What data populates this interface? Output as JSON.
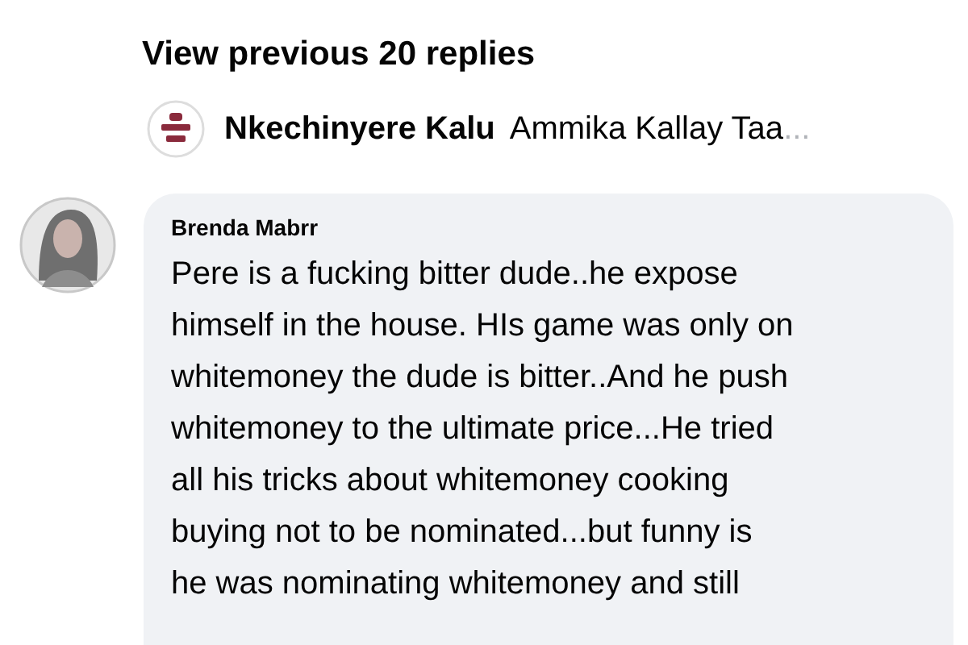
{
  "view_previous": "View previous 20 replies",
  "reply_preview": {
    "author": "Nkechinyere Kalu",
    "text": "Ammika Kallay Taa",
    "ellipsis": "..."
  },
  "comment": {
    "author": "Brenda Mabrr",
    "lines": [
      "Pere is a fucking bitter dude..he expose",
      "himself in the house. HIs game was only on",
      "whitemoney the dude is bitter..And he push",
      "whitemoney to the ultimate price...He tried",
      "all his tricks about whitemoney cooking",
      "buying not to be nominated...but funny is",
      "he was nominating whitemoney and still"
    ]
  }
}
